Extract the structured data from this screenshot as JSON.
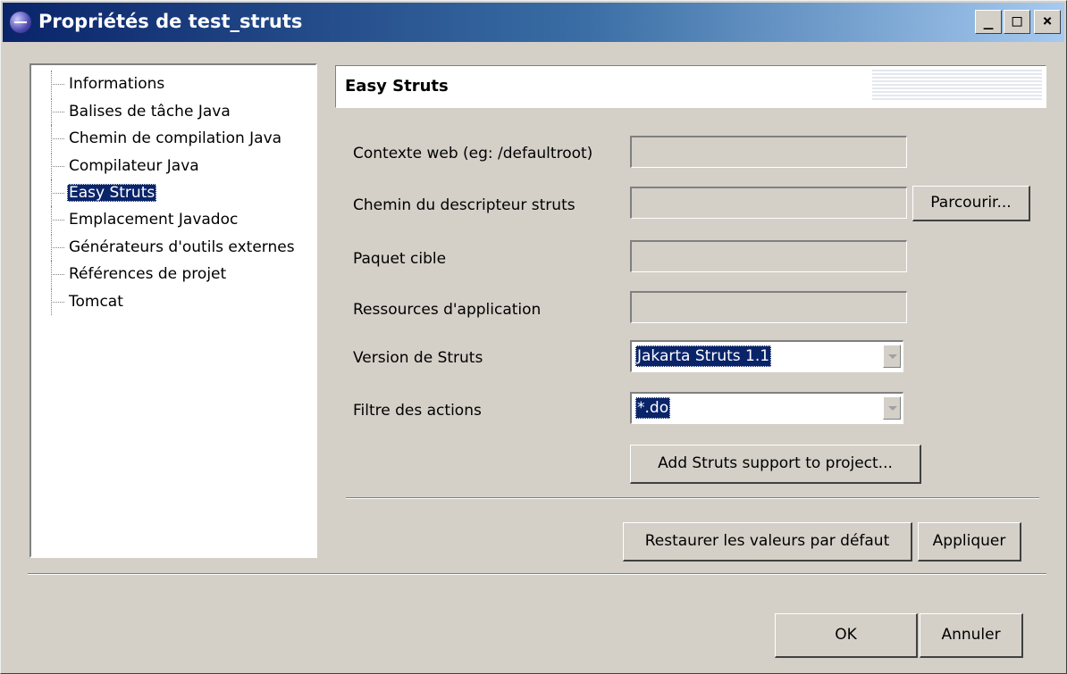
{
  "window": {
    "title": "Propriétés de test_struts",
    "controls": {
      "minimize": "_",
      "maximize": "□",
      "close": "×"
    }
  },
  "tree": {
    "items": [
      {
        "label": "Informations",
        "selected": false
      },
      {
        "label": "Balises de tâche Java",
        "selected": false
      },
      {
        "label": "Chemin de compilation Java",
        "selected": false
      },
      {
        "label": "Compilateur Java",
        "selected": false
      },
      {
        "label": "Easy Struts",
        "selected": true
      },
      {
        "label": "Emplacement Javadoc",
        "selected": false
      },
      {
        "label": "Générateurs d'outils externes",
        "selected": false
      },
      {
        "label": "Références de projet",
        "selected": false
      },
      {
        "label": "Tomcat",
        "selected": false
      }
    ]
  },
  "panel": {
    "title": "Easy Struts",
    "fields": {
      "web_context": {
        "label": "Contexte web (eg: /defaultroot)",
        "value": ""
      },
      "descriptor_path": {
        "label": "Chemin du descripteur struts",
        "value": ""
      },
      "target_package": {
        "label": "Paquet cible",
        "value": ""
      },
      "app_resources": {
        "label": "Ressources d'application",
        "value": ""
      },
      "struts_version": {
        "label": "Version de Struts",
        "value": "Jakarta Struts 1.1"
      },
      "action_filter": {
        "label": "Filtre des actions",
        "value": "*.do"
      }
    },
    "browse_button": "Parcourir...",
    "add_support_button": "Add Struts support to project...",
    "restore_defaults_button": "Restaurer les valeurs par défaut",
    "apply_button": "Appliquer"
  },
  "footer": {
    "ok_button": "OK",
    "cancel_button": "Annuler"
  },
  "colors": {
    "titlebar_start": "#0a246a",
    "titlebar_end": "#a6caf0",
    "selection": "#0a246a",
    "face": "#d4d0c8"
  }
}
